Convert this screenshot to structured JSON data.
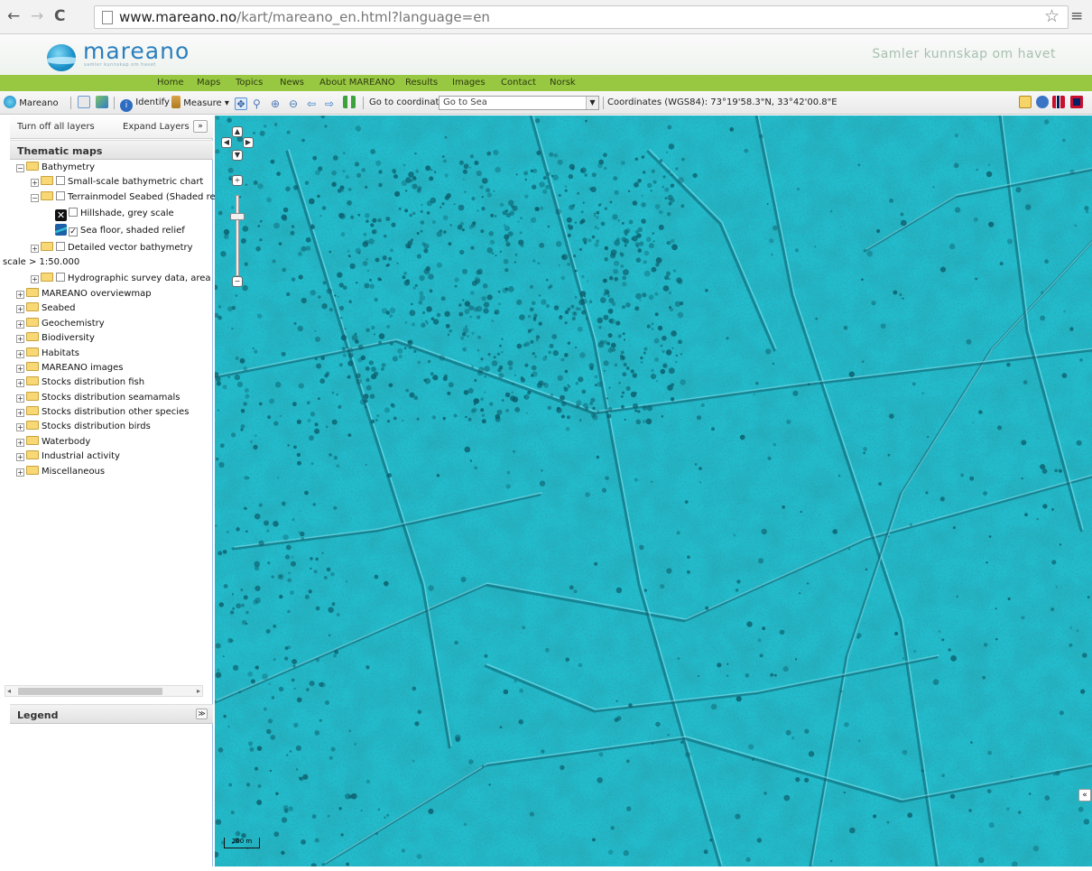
{
  "browser": {
    "url_host": "www.mareano.no",
    "url_path": "/kart/mareano_en.html?language=en"
  },
  "header": {
    "logo_text": "mareano",
    "logo_subtext": "samler kunnskap om havet",
    "slogan": "Samler kunnskap om havet"
  },
  "nav": {
    "items": [
      "Home",
      "Maps",
      "Topics",
      "News",
      "About MAREANO",
      "Results",
      "Images",
      "Contact",
      "Norsk"
    ]
  },
  "toolbar": {
    "mareano_label": "Mareano",
    "identify_label": "Identify",
    "measure_label": "Measure",
    "goto_label": "Go to coordinate",
    "sea_select_value": "Go to Sea",
    "coordinates_label": "Coordinates (WGS84): 73°19'58.3\"N, 33°42'00.8\"E"
  },
  "sidebar": {
    "turn_off_label": "Turn off all layers",
    "expand_label": "Expand Layers",
    "expand_button": "»",
    "thematic_title": "Thematic maps",
    "legend_title": "Legend",
    "tree": [
      {
        "label": "Bathymetry"
      },
      {
        "label": "Small-scale bathymetric chart"
      },
      {
        "label": "Terrainmodel Seabed (Shaded relief"
      },
      {
        "label": "Hillshade, grey scale"
      },
      {
        "label": "Sea floor, shaded relief",
        "checked": true
      },
      {
        "label": "Detailed vector bathymetry"
      },
      {
        "label": "scale > 1:50.000"
      },
      {
        "label": "Hydrographic survey data, area of c"
      },
      {
        "label": "MAREANO overviewmap"
      },
      {
        "label": "Seabed"
      },
      {
        "label": "Geochemistry"
      },
      {
        "label": "Biodiversity"
      },
      {
        "label": "Habitats"
      },
      {
        "label": "MAREANO images"
      },
      {
        "label": "Stocks distribution fish"
      },
      {
        "label": "Stocks distribution seamamals"
      },
      {
        "label": "Stocks distribution other species"
      },
      {
        "label": "Stocks distribution birds"
      },
      {
        "label": "Waterbody"
      },
      {
        "label": "Industrial activity"
      },
      {
        "label": "Miscellaneous"
      }
    ]
  },
  "map": {
    "base_color": "#1fb8c9",
    "shadow_color": "#0b5d6b",
    "highlight_color": "#7fe3ee",
    "scale_label": "200 m"
  }
}
